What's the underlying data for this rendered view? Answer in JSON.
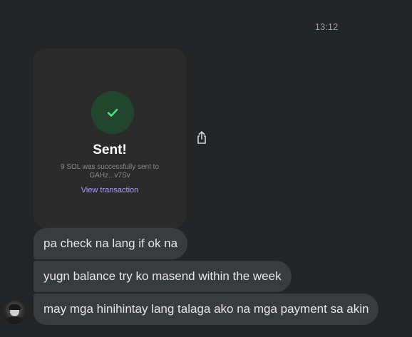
{
  "chat": {
    "timestamp": "13:12",
    "card": {
      "title": "Sent!",
      "description": "9 SOL was successfully sent to GAHz...v7Sv",
      "link_label": "View transaction",
      "icon": "check-icon",
      "accent_color": "#4ade80"
    },
    "share_icon": "share-icon",
    "messages": [
      {
        "text": "pa check na lang  if ok  na"
      },
      {
        "text": "yugn balance try ko masend within the week"
      },
      {
        "text": "may mga hinihintay lang talaga ako na mga payment sa akin"
      }
    ]
  }
}
